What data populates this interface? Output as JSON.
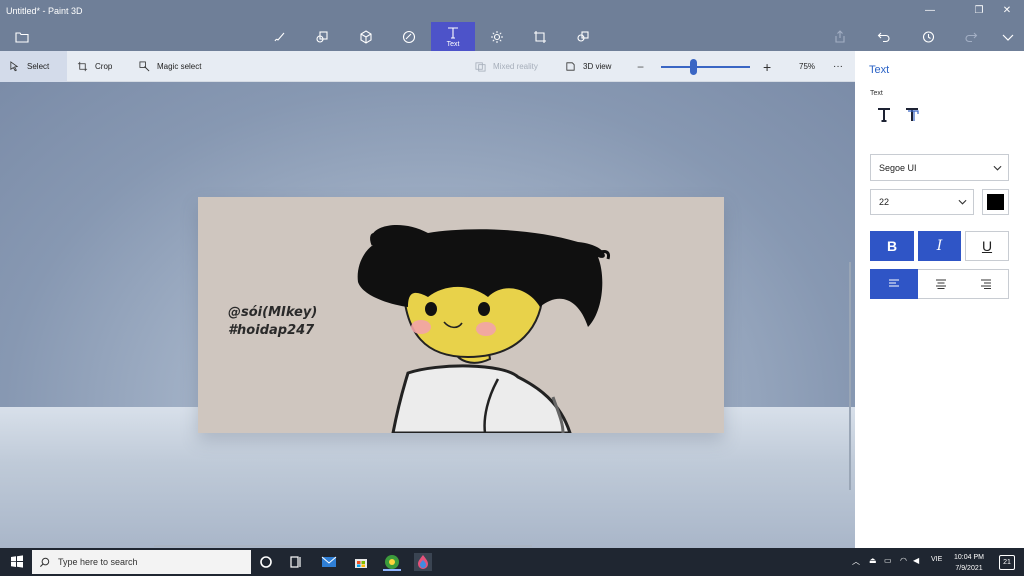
{
  "window": {
    "title": "Untitled* - Paint 3D"
  },
  "toolbar": {
    "active_label": "Text"
  },
  "ribbon": {
    "select": "Select",
    "crop": "Crop",
    "magic_select": "Magic select",
    "mixed_reality": "Mixed reality",
    "view_3d": "3D view",
    "zoom": "75%",
    "zoom_minus": "−",
    "zoom_plus": "+",
    "more": "···"
  },
  "canvas": {
    "line1": "@sói(MIkey)",
    "line2": "#hoidap247"
  },
  "panel": {
    "title": "Text",
    "subtitle": "Text",
    "font": "Segoe UI",
    "size": "22",
    "color": "#000000",
    "bold": "B",
    "italic": "I",
    "underline": "U"
  },
  "taskbar": {
    "search_placeholder": "Type here to search",
    "time": "10:04 PM",
    "date": "7/9/2021",
    "lang": "VIE",
    "notifications": "21"
  }
}
